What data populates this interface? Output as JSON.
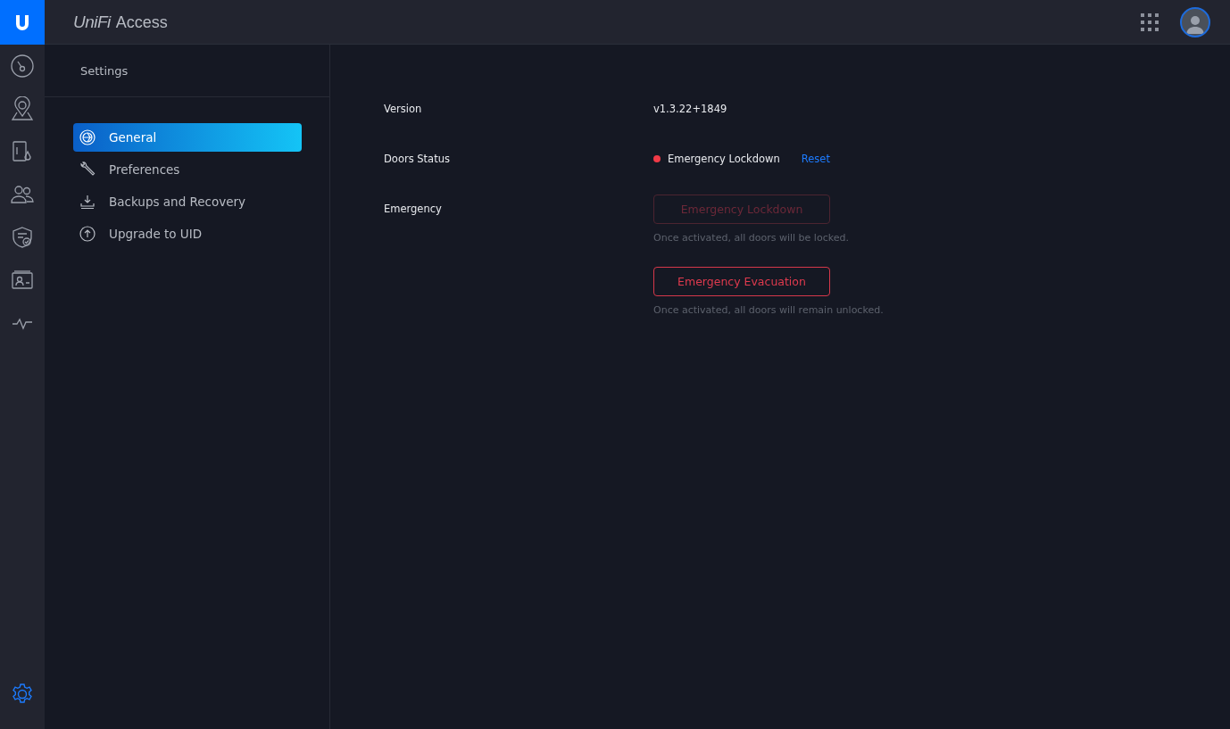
{
  "header": {
    "brand": "UniFi",
    "product": "Access"
  },
  "rail": [
    {
      "kind": "gauge",
      "selected": false
    },
    {
      "kind": "pin",
      "selected": false
    },
    {
      "kind": "door",
      "selected": false
    },
    {
      "kind": "users",
      "selected": false
    },
    {
      "kind": "shield",
      "selected": false
    },
    {
      "kind": "card",
      "selected": false
    },
    {
      "kind": "pulse",
      "selected": false
    },
    {
      "kind": "gear",
      "selected": true
    }
  ],
  "panel": {
    "title": "Settings",
    "items": [
      {
        "label": "General",
        "kind": "globe",
        "selected": true
      },
      {
        "label": "Preferences",
        "kind": "wrench",
        "selected": false
      },
      {
        "label": "Backups and Recovery",
        "kind": "download",
        "selected": false
      },
      {
        "label": "Upgrade to UID",
        "kind": "upload",
        "selected": false
      }
    ]
  },
  "rows": [
    {
      "kind": "text",
      "label": "Version",
      "value": "v1.3.22+1849"
    },
    {
      "kind": "status",
      "label": "Doors Status",
      "value": "Emergency Lockdown",
      "color": "#f03a47",
      "action": "Reset"
    },
    {
      "kind": "buttons",
      "label": "Emergency",
      "buttons": [
        {
          "label": "Emergency Lockdown",
          "disabled": true,
          "hint": "Once activated, all doors will be locked."
        },
        {
          "label": "Emergency Evacuation",
          "disabled": false,
          "hint": "Once activated, all doors will remain unlocked."
        }
      ]
    }
  ]
}
